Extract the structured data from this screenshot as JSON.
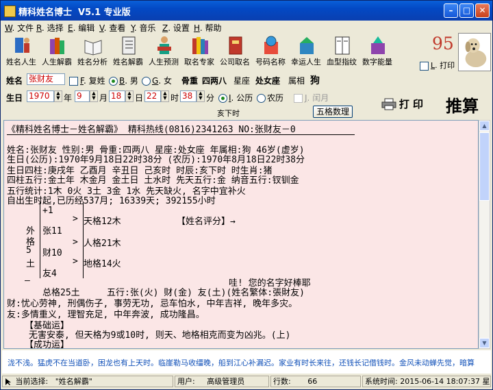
{
  "window": {
    "title": "精科姓名博士  V5.1 专业版",
    "score": "95"
  },
  "menu": [
    {
      "key": "W",
      "label": "文件"
    },
    {
      "key": "R",
      "label": "选择"
    },
    {
      "key": "E",
      "label": "编辑"
    },
    {
      "key": "V",
      "label": "查看"
    },
    {
      "key": "Y",
      "label": "音乐"
    },
    {
      "key": "Z",
      "label": "设置"
    },
    {
      "key": "H",
      "label": "帮助"
    }
  ],
  "toolbar": [
    {
      "label": "姓名人生",
      "icon": "person-book-icon"
    },
    {
      "label": "人生解霸",
      "icon": "books-icon"
    },
    {
      "label": "姓名分析",
      "icon": "open-book-icon"
    },
    {
      "label": "姓名解霸",
      "icon": "notebook-icon"
    },
    {
      "label": "人生预测",
      "icon": "reader-icon"
    },
    {
      "label": "取名专家",
      "icon": "book-stack-icon"
    },
    {
      "label": "公司取名",
      "icon": "red-book-icon"
    },
    {
      "label": "号码名称",
      "icon": "globe-book-icon"
    },
    {
      "label": "幸运人生",
      "icon": "lucky-icon"
    },
    {
      "label": "血型指纹",
      "icon": "magazine-icon"
    },
    {
      "label": "数字能量",
      "icon": "gem-book-icon"
    }
  ],
  "print_checkbox": {
    "key": "L",
    "label": "打印"
  },
  "form": {
    "name_label": "姓名",
    "name_value": "张财友",
    "compound_key": "F",
    "compound_label": "复姓",
    "male_key": "B",
    "male_label": "男",
    "female_key": "G",
    "female_label": "女",
    "bone_label": "骨重",
    "bone_value": "四两八",
    "star_label": "星座",
    "star_value": "处女座",
    "zodiac_label": "属相",
    "zodiac_value": "狗",
    "birth_label": "生日",
    "year": "1970",
    "year_unit": "年",
    "month": "9",
    "month_unit": "月",
    "day": "18",
    "day_unit": "日",
    "hour": "22",
    "hour_unit": "时",
    "minute": "38",
    "minute_unit": "分",
    "solar_key": "I",
    "solar_label": "公历",
    "lunar_label": "农历",
    "leap_key": "J",
    "leap_label": "闰月",
    "shichen": "亥下时",
    "five_grid_button": "五格数理",
    "print_button": "打 印",
    "calc_button": "推算"
  },
  "content": {
    "header": "《精科姓名博士－姓名解霸》   精科热线(0816)2341263  NO:张财友－0",
    "lines": [
      "姓名:张财友 性别:男 骨重:四两八 星座:处女座 年属相:狗 46岁(虚岁)",
      "生日(公历):1970年9月18日22时38分  (农历):1970年8月18日22时38分",
      "生日四柱:庚戌年 乙酉月 辛丑日 己亥时 时辰:亥下时  时生肖:猪",
      "四柱五行:金土年 木金月 金土日 土水时 先天五行:金  纳音五行:钗钏金",
      "五行统计:1木 0火 3土 3金 1水 先天缺火, 名字中宜补火",
      "自出生时起,已历经537月; 16339天; 392155小时"
    ],
    "grid": {
      "plus_one": "+1",
      "outer_label": [
        "外",
        "格",
        "5",
        "土"
      ],
      "surname": "张11",
      "given1": "财10",
      "given2": "友4",
      "heaven": "天格12木",
      "person": "人格21木",
      "earth": "地格14火",
      "total": "总格25土",
      "score_title": "【姓名评分】→",
      "praise": "哇! 您的名字好棒耶",
      "elements": "五行:张(火) 财(金) 友(土)(姓名繁体:張財友)"
    },
    "analysis": [
      "财:忧心劳神, 刑偶伤子, 事劳无功, 忌车怕水, 中年吉祥, 晚年多灾。",
      "友:多情重义, 理智充足, 中年奔波, 成功隆昌。"
    ],
    "basic_title": "【基础运】",
    "basic_text": "无害安泰, 但天格为9或10时, 则天、地格相克而变为凶兆。(上)",
    "success_title": "【成功运】"
  },
  "marquee": "泷不浅。猛虎不在当道卧，困龙也有上天时。临崖勒马收缰晚，船到江心补漏迟。家业有时长来往，还钱长记借钱时。金风未动蝉先觉，暗算",
  "status": {
    "current_label": "当前选择:",
    "current_value": "\"姓名解霸\"",
    "user_label": "用户:",
    "user_value": "高级管理员",
    "rows_label": "行数:",
    "rows_value": "66",
    "time_label": "系统时间:",
    "time_value": "2015-06-14  18:07:37  星"
  }
}
